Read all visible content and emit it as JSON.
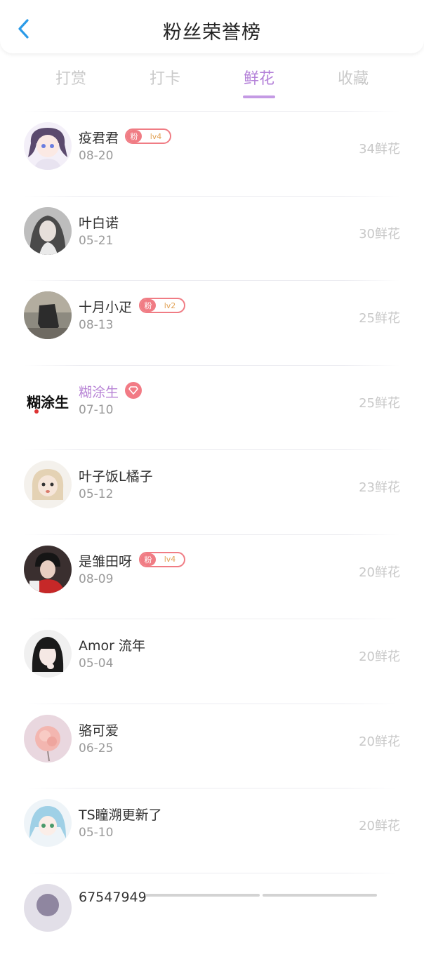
{
  "header": {
    "title": "粉丝荣誉榜",
    "back_icon": "chevron-left-icon",
    "accent": "#2b9be8"
  },
  "tabs": [
    {
      "label": "打赏",
      "active": false
    },
    {
      "label": "打卡",
      "active": false
    },
    {
      "label": "鲜花",
      "active": true
    },
    {
      "label": "收藏",
      "active": false
    }
  ],
  "colors": {
    "tab_active": "#b37fd8",
    "badge": "#f07c84",
    "vip_name": "#b783d5"
  },
  "fans": [
    {
      "name": "疫君君",
      "date": "08-20",
      "count": "34鲜花",
      "badge_fen": "粉",
      "badge_lv": "lv4",
      "avatar": "anime-girl-avatar"
    },
    {
      "name": "叶白诺",
      "date": "05-21",
      "count": "30鲜花",
      "avatar": "portrait-avatar"
    },
    {
      "name": "十月小疋",
      "date": "08-13",
      "count": "25鲜花",
      "badge_fen": "粉",
      "badge_lv": "lv2",
      "avatar": "dark-figure-avatar"
    },
    {
      "name": "糊涂生",
      "date": "07-10",
      "count": "25鲜花",
      "vip": true,
      "avatar": "calligraphy-avatar",
      "calligraphy": "糊涂生"
    },
    {
      "name": "叶子饭L橘子",
      "date": "05-12",
      "count": "23鲜花",
      "avatar": "cartoon-avatar"
    },
    {
      "name": "是雏田呀",
      "date": "08-09",
      "count": "20鲜花",
      "badge_fen": "粉",
      "badge_lv": "lv4",
      "avatar": "boy-avatar"
    },
    {
      "name": "Amor 流年",
      "date": "05-04",
      "count": "20鲜花",
      "avatar": "girl-portrait-avatar"
    },
    {
      "name": "骆可爱",
      "date": "06-25",
      "count": "20鲜花",
      "avatar": "flower-avatar"
    },
    {
      "name": "TS瞳溯更新了",
      "date": "05-10",
      "count": "20鲜花",
      "avatar": "anime-blue-hair-avatar"
    },
    {
      "name": "67547949",
      "date": "",
      "count": "",
      "avatar": "partial-avatar"
    }
  ]
}
